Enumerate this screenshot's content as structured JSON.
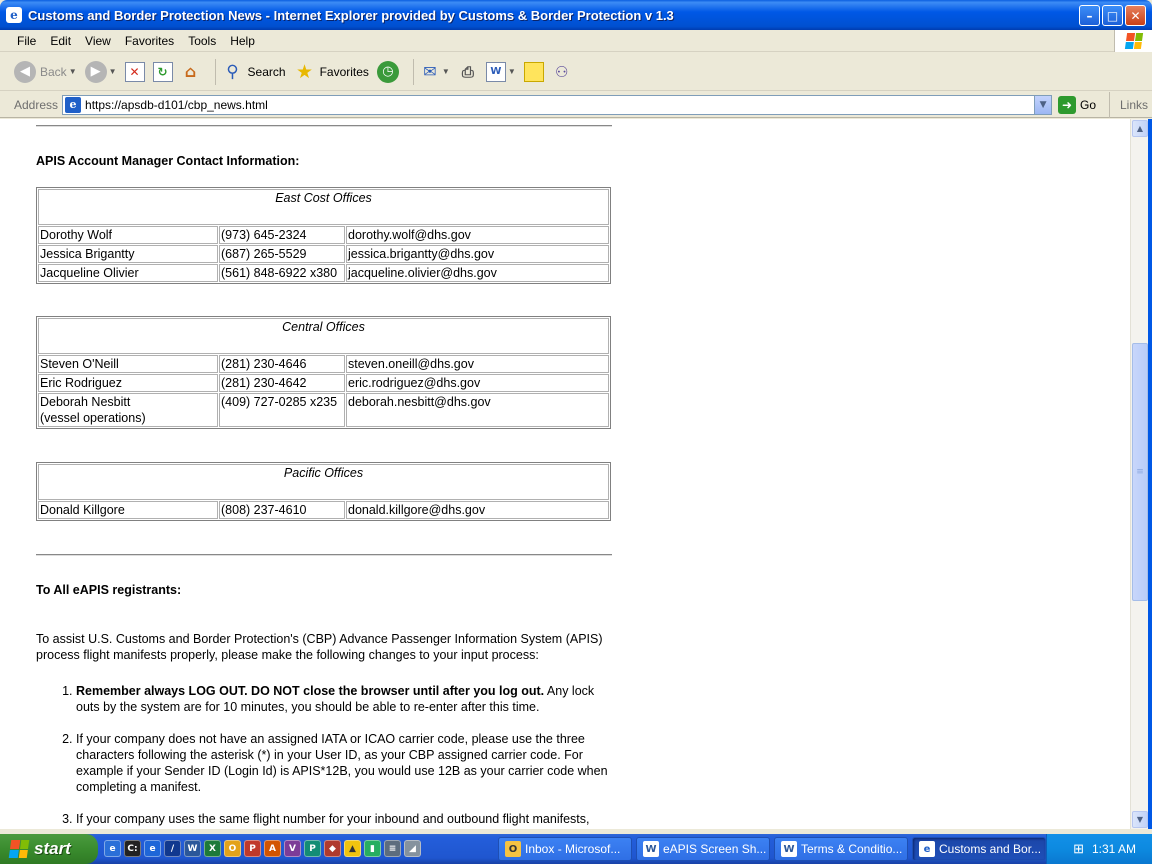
{
  "window": {
    "title": "Customs and Border Protection News - Internet Explorer provided by Customs & Border Protection v 1.3"
  },
  "menu": [
    "File",
    "Edit",
    "View",
    "Favorites",
    "Tools",
    "Help"
  ],
  "toolbar": {
    "back": "Back",
    "search": "Search",
    "favorites": "Favorites"
  },
  "address": {
    "label": "Address",
    "url": "https://apsdb-d101/cbp_news.html",
    "go": "Go",
    "links": "Links"
  },
  "content": {
    "contact_heading": "APIS Account Manager Contact Information:",
    "offices": [
      {
        "name": "East Cost Offices",
        "rows": [
          [
            "Dorothy Wolf",
            "(973) 645-2324",
            "dorothy.wolf@dhs.gov"
          ],
          [
            "Jessica Brigantty",
            "(687) 265-5529",
            "jessica.brigantty@dhs.gov"
          ],
          [
            "Jacqueline Olivier",
            "(561) 848-6922 x380",
            "jacqueline.olivier@dhs.gov"
          ]
        ]
      },
      {
        "name": "Central Offices",
        "rows": [
          [
            "Steven O'Neill",
            "(281) 230-4646",
            "steven.oneill@dhs.gov"
          ],
          [
            "Eric Rodriguez",
            "(281) 230-4642",
            "eric.rodriguez@dhs.gov"
          ],
          [
            "Deborah Nesbitt",
            "(409) 727-0285 x235",
            "deborah.nesbitt@dhs.gov"
          ]
        ],
        "extra": "(vessel operations)"
      },
      {
        "name": "Pacific Offices",
        "rows": [
          [
            "Donald Killgore",
            "(808) 237-4610",
            "donald.killgore@dhs.gov"
          ]
        ]
      }
    ],
    "registrants_heading": "To All eAPIS registrants:",
    "intro": "To assist U.S. Customs and Border Protection's (CBP) Advance Passenger Information System (APIS) process flight manifests properly, please make the following changes to your input process:",
    "steps": [
      {
        "bold": "Remember always LOG OUT. DO NOT close the browser until after you log out.",
        "text": " Any lock outs by the system are for 10 minutes, you should be able to re-enter after this time."
      },
      {
        "bold": "",
        "text": "If your company does not have an assigned IATA or ICAO carrier code, please use the three characters following the asterisk (*) in your User ID, as your CBP assigned carrier code. For example if your Sender ID (Login Id) is APIS*12B, you would use 12B as your carrier code when completing a manifest."
      },
      {
        "bold": "",
        "text": "If your company uses the same flight number for your inbound and outbound flight manifests, you must use a distinct character, in the flight number, to distinguish an inbound from an"
      }
    ]
  },
  "taskbar": {
    "start": "start",
    "tasks": [
      "Inbox - Microsof...",
      "eAPIS Screen Sh...",
      "Terms & Conditio...",
      "Customs and Bor..."
    ],
    "clock": "1:31 AM"
  },
  "colors": {
    "xp_blue": "#0058e6",
    "start_green": "#3a8c2e"
  }
}
